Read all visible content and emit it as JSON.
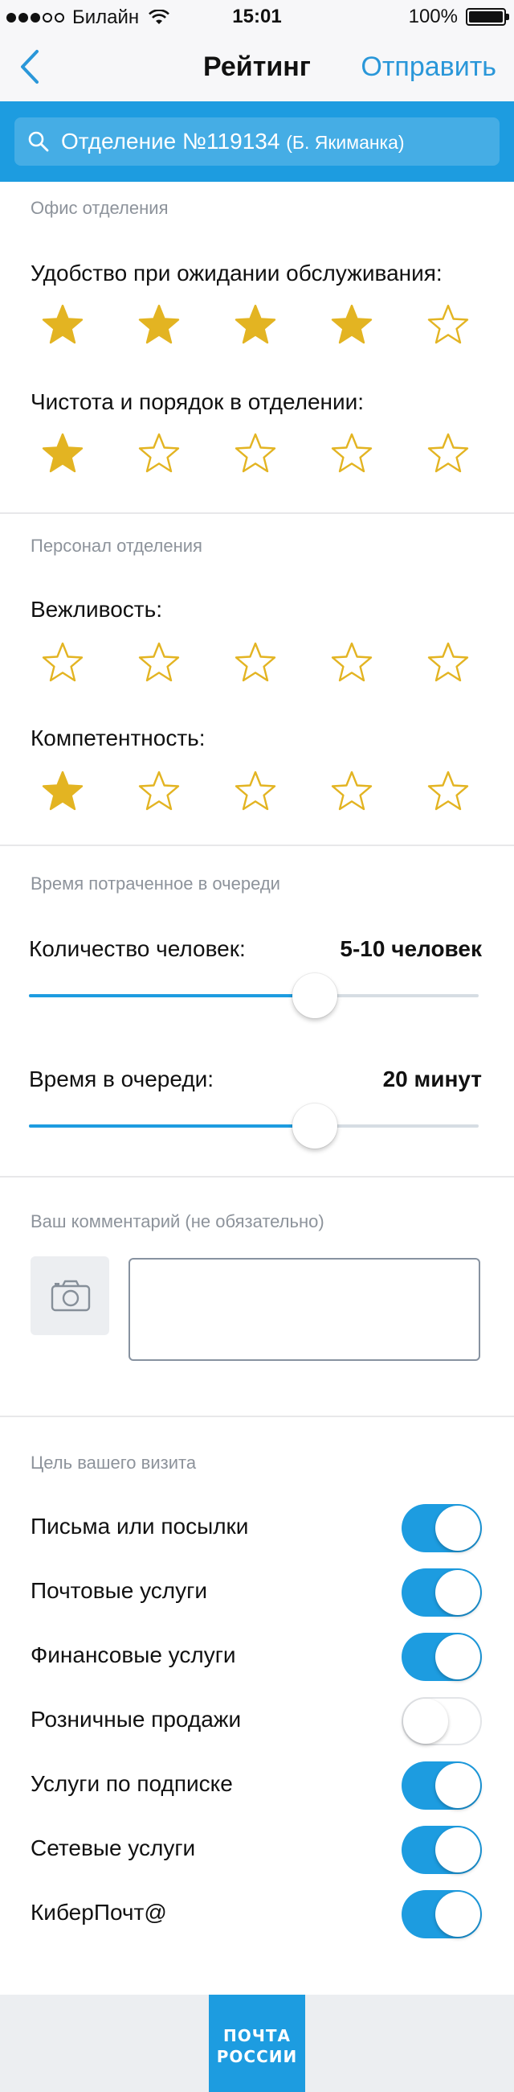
{
  "status_bar": {
    "carrier": "Билайн",
    "time": "15:01",
    "battery": "100%",
    "battery_level": 1.0
  },
  "nav": {
    "title": "Рейтинг",
    "send_label": "Отправить"
  },
  "search": {
    "office": "Отделение №119134",
    "office_sub": "(Б. Якиманка)"
  },
  "office_section": {
    "header": "Офис отделения",
    "questions": [
      {
        "label": "Удобство при ожидании обслуживания:",
        "rating": 4,
        "max": 5
      },
      {
        "label": "Чистота и порядок в отделении:",
        "rating": 1,
        "max": 5
      }
    ]
  },
  "staff_section": {
    "header": "Персонал отделения",
    "questions": [
      {
        "label": "Вежливость:",
        "rating": 0,
        "max": 5
      },
      {
        "label": "Компетентность:",
        "rating": 1,
        "max": 5
      }
    ]
  },
  "queue_section": {
    "header": "Время потраченное в очереди",
    "sliders": [
      {
        "label": "Количество человек:",
        "value": "5-10 человек",
        "level": 0.635
      },
      {
        "label": "Время в очереди:",
        "value": "20 минут",
        "level": 0.635
      }
    ]
  },
  "comment_section": {
    "header": "Ваш комментарий (не обязательно)",
    "value": ""
  },
  "purpose_section": {
    "header": "Цель вашего визита",
    "items": [
      {
        "label": "Письма или посылки",
        "on": true
      },
      {
        "label": "Почтовые услуги",
        "on": true
      },
      {
        "label": "Финансовые услуги",
        "on": true
      },
      {
        "label": "Розничные продажи",
        "on": false
      },
      {
        "label": "Услуги по подписке",
        "on": true
      },
      {
        "label": "Сетевые услуги",
        "on": true
      },
      {
        "label": "КиберПочт@",
        "on": true
      }
    ]
  },
  "footer": {
    "logo_line1": "ПОЧТА",
    "logo_line2": "РОССИИ"
  },
  "colors": {
    "accent": "#1d9ce0",
    "star_gold": "#e3b422",
    "nav_link": "#2a97d9"
  }
}
